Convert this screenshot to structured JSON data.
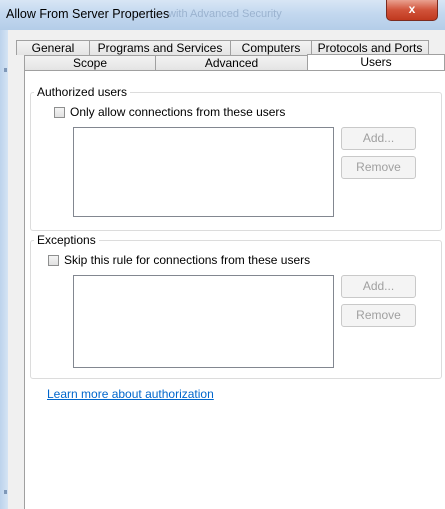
{
  "window": {
    "title": "Allow From Server Properties",
    "ghost_title": "with Advanced Security",
    "close_label": "x"
  },
  "tabs": {
    "row1": [
      "General",
      "Programs and Services",
      "Computers",
      "Protocols and Ports"
    ],
    "row2": [
      "Scope",
      "Advanced",
      "Users"
    ],
    "active": "Users"
  },
  "authorized": {
    "group_title": "Authorized users",
    "checkbox_label": "Only allow connections from these users",
    "checked": false,
    "add_label": "Add...",
    "remove_label": "Remove"
  },
  "exceptions": {
    "group_title": "Exceptions",
    "checkbox_label": "Skip this rule for connections from these users",
    "checked": false,
    "add_label": "Add...",
    "remove_label": "Remove"
  },
  "learn_more_link": "Learn more about authorization",
  "colors": {
    "link": "#0066cc",
    "disabled_text": "#a0a0a0",
    "close_button": "#c0391f"
  }
}
